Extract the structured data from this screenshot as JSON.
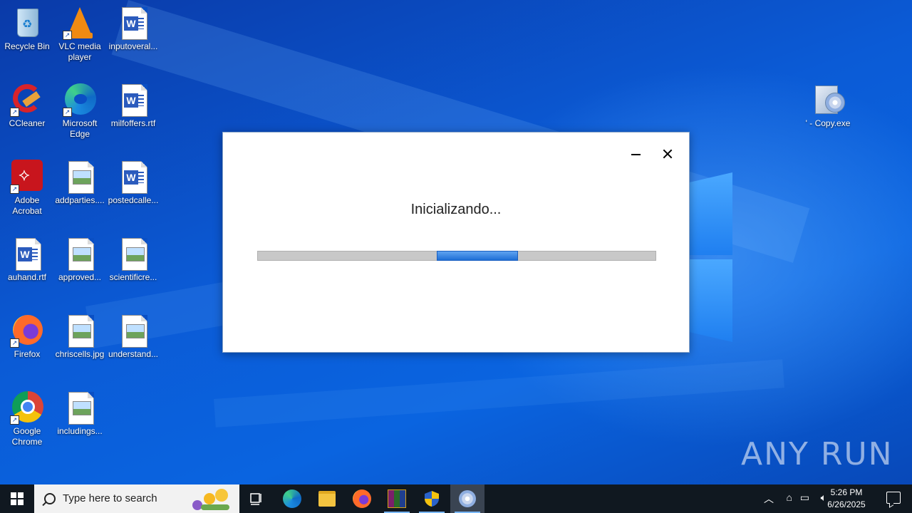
{
  "desktop": {
    "icons": [
      {
        "label": "Recycle Bin"
      },
      {
        "label": "VLC media player"
      },
      {
        "label": "inputoveral..."
      },
      {
        "label": "CCleaner"
      },
      {
        "label": "Microsoft Edge"
      },
      {
        "label": "milfoffers.rtf"
      },
      {
        "label": "Adobe Acrobat"
      },
      {
        "label": "addparties...."
      },
      {
        "label": "postedcalle..."
      },
      {
        "label": "auhand.rtf"
      },
      {
        "label": "approved..."
      },
      {
        "label": "scientificre..."
      },
      {
        "label": "Firefox"
      },
      {
        "label": "chriscells.jpg"
      },
      {
        "label": "understand..."
      },
      {
        "label": "Google Chrome"
      },
      {
        "label": "includings..."
      },
      {
        "label": "' - Copy.exe"
      }
    ]
  },
  "dialog": {
    "status": "Inicializando...",
    "progress_start": 0.45,
    "progress_end": 0.65
  },
  "watermark": "ANY RUN",
  "taskbar": {
    "search_placeholder": "Type here to search",
    "time": "5:26 PM",
    "date": "6/26/2025",
    "apps": [
      "task-view",
      "edge",
      "file-explorer",
      "firefox",
      "winrar",
      "security-shield",
      "installer"
    ]
  }
}
